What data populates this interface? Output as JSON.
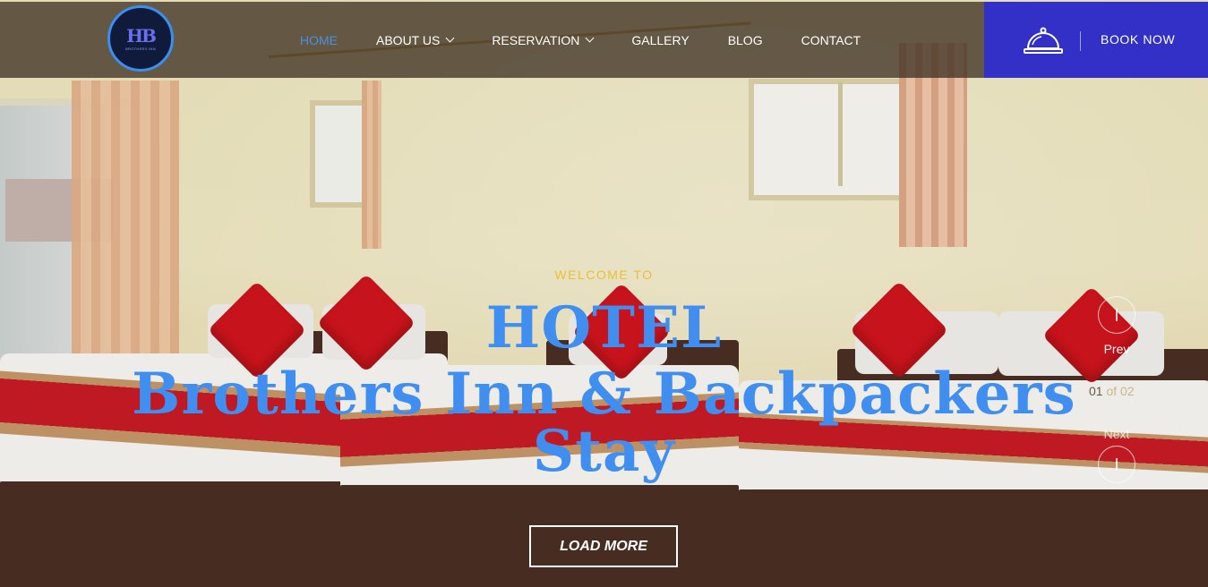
{
  "brand": {
    "logo_mark": "HB",
    "logo_text": "BROTHERS INN"
  },
  "nav": {
    "items": [
      {
        "label": "HOME",
        "active": true,
        "dropdown": false
      },
      {
        "label": "ABOUT US",
        "active": false,
        "dropdown": true
      },
      {
        "label": "RESERVATION",
        "active": false,
        "dropdown": true
      },
      {
        "label": "GALLERY",
        "active": false,
        "dropdown": false
      },
      {
        "label": "BLOG",
        "active": false,
        "dropdown": false
      },
      {
        "label": "CONTACT",
        "active": false,
        "dropdown": false
      }
    ]
  },
  "booking": {
    "label": "BOOK NOW",
    "icon": "service-bell-icon"
  },
  "hero": {
    "welcome": "WELCOME TO",
    "title_line1": "HOTEL",
    "title_line2": "Brothers Inn & Backpackers",
    "title_line3": "Stay",
    "cta_label": "LOAD MORE"
  },
  "slider": {
    "prev_label": "Prev",
    "next_label": "Next",
    "current": "01",
    "of": "of",
    "total": "02"
  },
  "colors": {
    "accent": "#3330c8",
    "nav_active": "#4d8fe0",
    "title": "#3f8ef0",
    "welcome": "#e8c03a",
    "header_overlay": "#40322480"
  }
}
